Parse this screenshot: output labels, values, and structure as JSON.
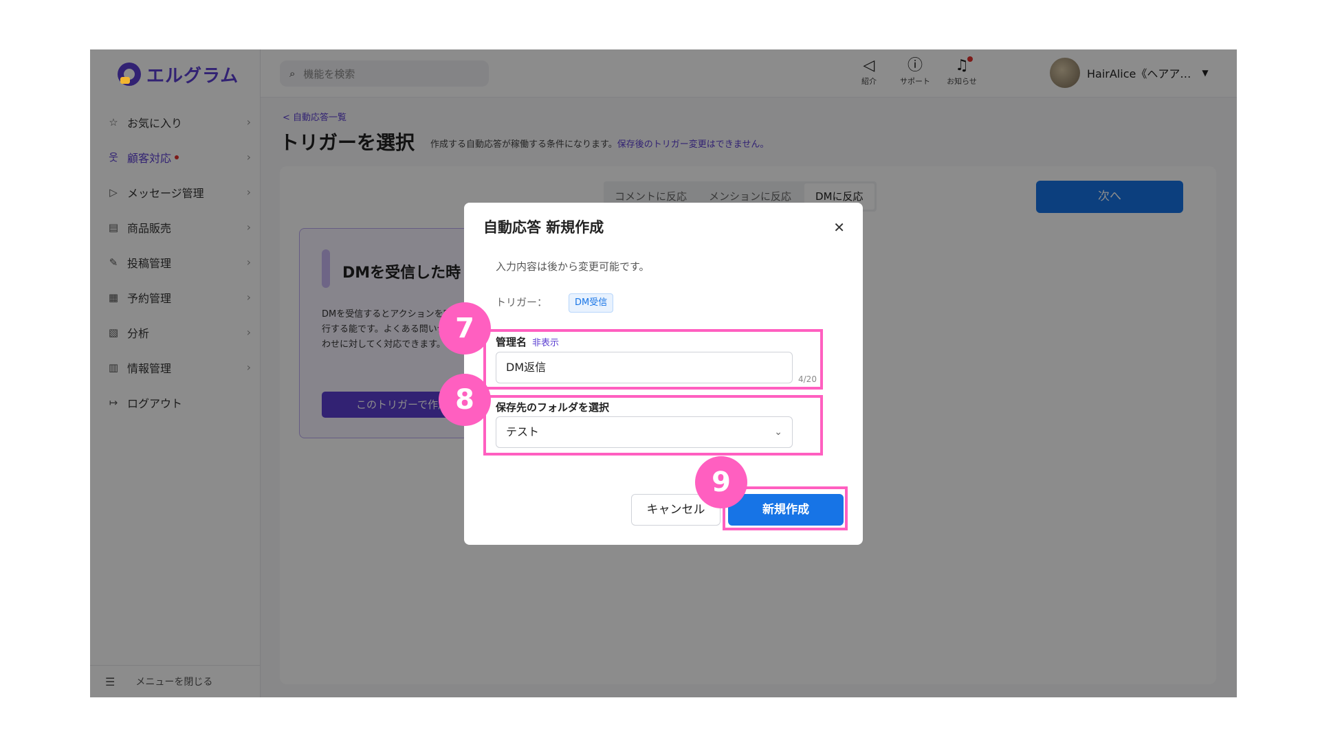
{
  "sidebar": {
    "logo_text": "エルグラム",
    "items": [
      {
        "label": "お気に入り",
        "icon": "☆"
      },
      {
        "label": "顧客対応",
        "icon": "웃"
      },
      {
        "label": "メッセージ管理",
        "icon": "▷"
      },
      {
        "label": "商品販売",
        "icon": "▤"
      },
      {
        "label": "投稿管理",
        "icon": "✎"
      },
      {
        "label": "予約管理",
        "icon": "▦"
      },
      {
        "label": "分析",
        "icon": "▧"
      },
      {
        "label": "情報管理",
        "icon": "▥"
      },
      {
        "label": "ログアウト",
        "icon": "↦"
      }
    ],
    "close_menu": "メニューを閉じる"
  },
  "header": {
    "search_placeholder": "機能を検索",
    "icons": {
      "intro": "紹介",
      "support": "サポート",
      "notice": "お知らせ"
    },
    "user_name": "HairAlice《ヘアア…"
  },
  "main": {
    "breadcrumb": "< 自動応答一覧",
    "title": "トリガーを選択",
    "desc": "作成する自動応答が稼働する条件になります。",
    "desc_warn": "保存後のトリガー変更はできません。",
    "tabs": [
      "コメントに反応",
      "メンションに反応",
      "DMに反応"
    ],
    "next_label": "次へ",
    "card": {
      "title": "DMを受信した時",
      "desc": "DMを受信するとアクションを実行する能です。よくある問い合わせに対してく対応できます。",
      "button": "このトリガーで作成"
    }
  },
  "modal": {
    "title": "自動応答 新規作成",
    "note": "入力内容は後から変更可能です。",
    "trigger_label": "トリガー：",
    "trigger_tag": "DM受信",
    "name_label": "管理名",
    "name_hide": "非表示",
    "name_value": "DM返信",
    "name_counter": "4/20",
    "folder_label": "保存先のフォルダを選択",
    "folder_value": "テスト",
    "cancel_label": "キャンセル",
    "create_label": "新規作成"
  },
  "annotations": {
    "step7": "7",
    "step8": "8",
    "step9": "9"
  },
  "colors": {
    "accent": "#5b3fd1",
    "primary": "#1774e6",
    "highlight": "#ff5fc0"
  }
}
